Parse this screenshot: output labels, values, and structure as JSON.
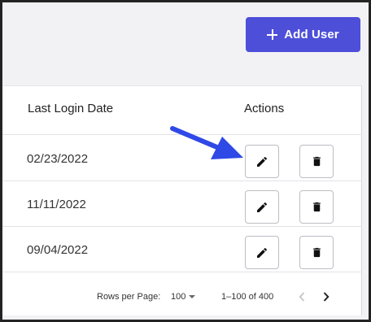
{
  "toolbar": {
    "add_user_label": "Add User"
  },
  "table": {
    "headers": {
      "last_login": "Last Login Date",
      "actions": "Actions"
    },
    "rows": [
      {
        "last_login": "02/23/2022"
      },
      {
        "last_login": "11/11/2022"
      },
      {
        "last_login": "09/04/2022"
      }
    ]
  },
  "pagination": {
    "rows_per_page_label": "Rows per Page:",
    "rows_per_page_value": "100",
    "range": "1–100 of 400"
  },
  "icons": {
    "add": "plus-icon",
    "edit": "pencil-icon",
    "delete": "trash-icon",
    "prev": "chevron-left-icon",
    "next": "chevron-right-icon",
    "annotation": "arrow-annotation"
  },
  "colors": {
    "accent": "#4d4fd9",
    "annotation": "#2f49e6"
  }
}
